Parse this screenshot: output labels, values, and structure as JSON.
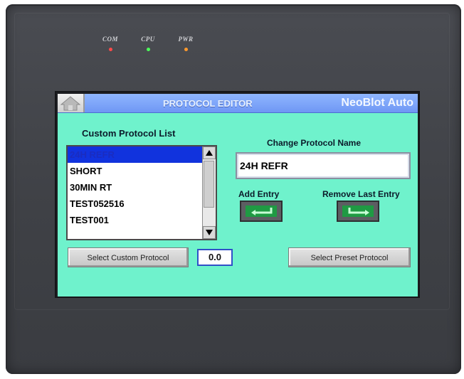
{
  "leds": [
    {
      "label": "COM",
      "color": "#ff4a4a"
    },
    {
      "label": "CPU",
      "color": "#4cff5a"
    },
    {
      "label": "PWR",
      "color": "#ff9a2e"
    }
  ],
  "title": {
    "text": "PROTOCOL EDITOR",
    "brand": "NeoBlot Auto"
  },
  "list": {
    "heading": "Custom Protocol List",
    "items": [
      "24H REFR",
      "SHORT",
      "30MIN RT",
      "TEST052516",
      "TEST001"
    ],
    "selected_index": 0
  },
  "select_custom_label": "Select Custom Protocol",
  "value_display": "0.0",
  "change_name": {
    "heading": "Change Protocol Name",
    "value": "24H REFR"
  },
  "add_entry_label": "Add Entry",
  "remove_last_label": "Remove Last Entry",
  "select_preset_label": "Select Preset Protocol",
  "colors": {
    "screen_bg": "#6ff2cc",
    "titlebar": "#7fa6ff",
    "selection": "#1133dd"
  }
}
